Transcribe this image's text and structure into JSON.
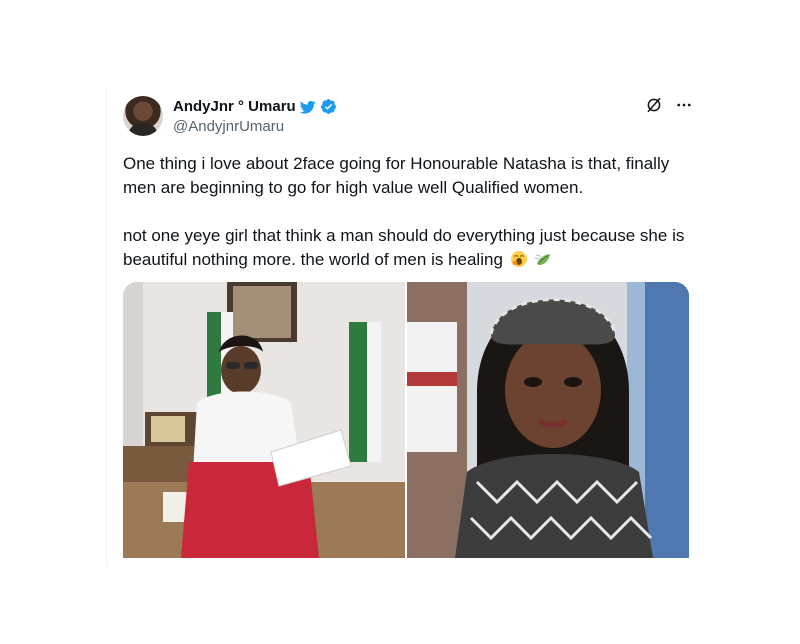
{
  "tweet": {
    "author": {
      "display_name": "AndyJnr ° Umaru",
      "handle": "@AndyjnrUmaru",
      "verified_color": "#1d9bf0"
    },
    "paragraphs": [
      "One thing i love about 2face going for Honourable Natasha is that, finally men are beginning to go for high value well Qualified women.",
      "not one yeye girl that think a man should do everything just because she is beautiful nothing more. the world of men is healing"
    ],
    "emojis": [
      "yawning-face-emoji",
      "leaf-fluttering-in-wind-emoji"
    ],
    "icons": {
      "bird": "twitter-bird-icon",
      "verified": "verified-badge-icon",
      "grok": "grok-icon",
      "more": "more-options-icon"
    },
    "media": [
      {
        "name": "photo-left"
      },
      {
        "name": "photo-right"
      }
    ]
  }
}
